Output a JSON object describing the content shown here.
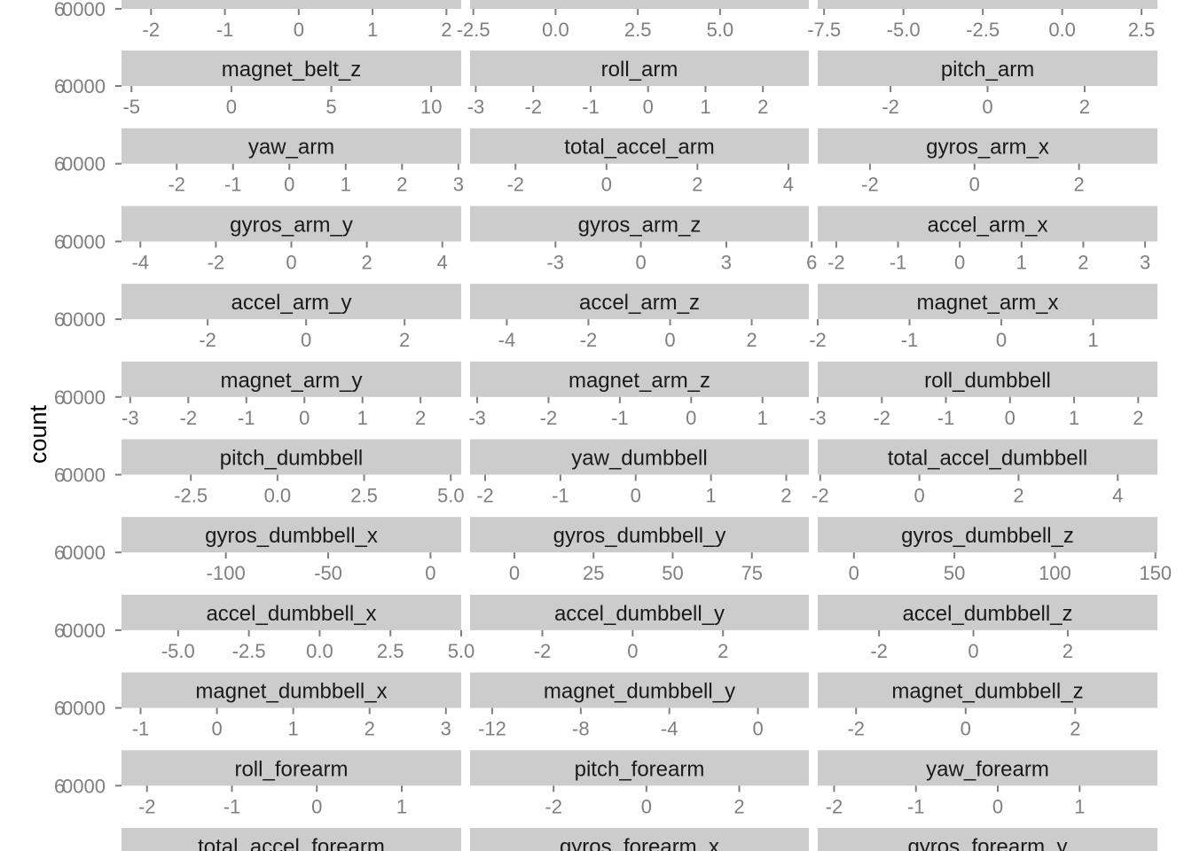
{
  "chart_data": {
    "type": "bar",
    "ylabel": "count",
    "y_tick_label": "0000",
    "y_tick_label_overlay": "6",
    "grid": false,
    "colors": {
      "strip_background": "#cccccc",
      "tick": "#7f7f7f",
      "strip_text": "#1a1a1a"
    },
    "top_partial_axes": [
      {
        "ticks": [
          -2,
          -1,
          0,
          1,
          2
        ],
        "range": [
          -2.4,
          2.2
        ]
      },
      {
        "ticks": [
          -2.5,
          0.0,
          2.5,
          5.0
        ],
        "tick_labels": [
          "-2.5",
          "0.0",
          "2.5",
          "5.0"
        ],
        "range": [
          -2.6,
          7.7
        ]
      },
      {
        "ticks": [
          -7.5,
          -5.0,
          -2.5,
          0.0,
          2.5
        ],
        "tick_labels": [
          "-7.5",
          "-5.0",
          "-2.5",
          "0.0",
          "2.5"
        ],
        "range": [
          -7.7,
          3.0
        ]
      }
    ],
    "panels": [
      {
        "name": "magnet_belt_z",
        "ticks": [
          -5,
          0,
          5,
          10
        ],
        "range": [
          -5.5,
          11.5
        ]
      },
      {
        "name": "roll_arm",
        "ticks": [
          -3,
          -2,
          -1,
          0,
          1,
          2
        ],
        "range": [
          -3.1,
          2.8
        ]
      },
      {
        "name": "pitch_arm",
        "ticks": [
          -2,
          0,
          2
        ],
        "range": [
          -3.5,
          3.5
        ]
      },
      {
        "name": "yaw_arm",
        "ticks": [
          -2,
          -1,
          0,
          1,
          2,
          3
        ],
        "range": [
          -2.98,
          3.05
        ]
      },
      {
        "name": "total_accel_arm",
        "ticks": [
          -2,
          0,
          2,
          4
        ],
        "range": [
          -3.0,
          4.45
        ]
      },
      {
        "name": "gyros_arm_x",
        "ticks": [
          -2,
          0,
          2
        ],
        "range": [
          -3.0,
          3.5
        ]
      },
      {
        "name": "gyros_arm_y",
        "ticks": [
          -4,
          -2,
          0,
          2,
          4
        ],
        "range": [
          -4.5,
          4.5
        ]
      },
      {
        "name": "gyros_arm_z",
        "ticks": [
          -3,
          0,
          3,
          6
        ],
        "range": [
          -6.0,
          5.9
        ]
      },
      {
        "name": "accel_arm_x",
        "ticks": [
          -2,
          -1,
          0,
          1,
          2,
          3
        ],
        "range": [
          -2.3,
          3.2
        ]
      },
      {
        "name": "accel_arm_y",
        "ticks": [
          -2,
          0,
          2
        ],
        "range": [
          -3.75,
          3.15
        ]
      },
      {
        "name": "accel_arm_z",
        "ticks": [
          -4,
          0,
          -2,
          2
        ],
        "tick_order": [
          -4,
          -2,
          0,
          2
        ],
        "range": [
          -4.9,
          3.4
        ]
      },
      {
        "name": "magnet_arm_x",
        "ticks": [
          -2,
          -1,
          0,
          1
        ],
        "range": [
          -2.0,
          1.7
        ]
      },
      {
        "name": "magnet_arm_y",
        "ticks": [
          -3,
          -2,
          -1,
          0,
          1,
          2
        ],
        "range": [
          -3.15,
          2.7
        ]
      },
      {
        "name": "magnet_arm_z",
        "ticks": [
          -3,
          -2,
          -1,
          0,
          1
        ],
        "range": [
          -3.1,
          1.65
        ]
      },
      {
        "name": "roll_dumbbell",
        "ticks": [
          -3,
          -2,
          -1,
          0,
          1,
          2
        ],
        "range": [
          -3.0,
          2.3
        ]
      },
      {
        "name": "pitch_dumbbell",
        "ticks": [
          -2.5,
          0.0,
          2.5,
          5.0
        ],
        "tick_labels": [
          "-2.5",
          "0.0",
          "2.5",
          "5.0"
        ],
        "range": [
          -4.5,
          5.3
        ]
      },
      {
        "name": "yaw_dumbbell",
        "ticks": [
          -2,
          -1,
          0,
          1,
          2
        ],
        "range": [
          -2.2,
          2.3
        ]
      },
      {
        "name": "total_accel_dumbbell",
        "ticks": [
          -2,
          0,
          2,
          4
        ],
        "range": [
          -2.05,
          4.8
        ]
      },
      {
        "name": "gyros_dumbbell_x",
        "ticks": [
          -100,
          -50,
          0
        ],
        "range": [
          -151,
          15
        ]
      },
      {
        "name": "gyros_dumbbell_y",
        "ticks": [
          0,
          25,
          50,
          75
        ],
        "range": [
          -14,
          93
        ]
      },
      {
        "name": "gyros_dumbbell_z",
        "ticks": [
          0,
          50,
          100,
          150
        ],
        "range": [
          -18,
          151
        ]
      },
      {
        "name": "accel_dumbbell_x",
        "ticks": [
          -5.0,
          -2.5,
          0.0,
          2.5,
          5.0
        ],
        "tick_labels": [
          "-5.0",
          "-2.5",
          "0.0",
          "2.5",
          "5.0"
        ],
        "range": [
          -7.0,
          5.0
        ]
      },
      {
        "name": "accel_dumbbell_y",
        "ticks": [
          -2,
          0,
          2
        ],
        "range": [
          -3.6,
          3.9
        ]
      },
      {
        "name": "accel_dumbbell_z",
        "ticks": [
          -2,
          0,
          2
        ],
        "range": [
          -3.3,
          3.9
        ]
      },
      {
        "name": "magnet_dumbbell_x",
        "ticks": [
          -1,
          0,
          1,
          2,
          3
        ],
        "range": [
          -1.25,
          3.2
        ]
      },
      {
        "name": "magnet_dumbbell_y",
        "ticks": [
          -12,
          -8,
          -4,
          0
        ],
        "range": [
          -13.0,
          2.3
        ]
      },
      {
        "name": "magnet_dumbbell_z",
        "ticks": [
          -2,
          0,
          2
        ],
        "range": [
          -2.7,
          3.5
        ]
      },
      {
        "name": "roll_forearm",
        "ticks": [
          -2,
          -1,
          0,
          1
        ],
        "range": [
          -2.3,
          1.7
        ]
      },
      {
        "name": "pitch_forearm",
        "ticks": [
          -2,
          0,
          2
        ],
        "range": [
          -3.8,
          3.5
        ]
      },
      {
        "name": "yaw_forearm",
        "ticks": [
          -2,
          -1,
          0,
          1
        ],
        "range": [
          -2.2,
          1.95
        ]
      },
      {
        "name": "total_accel_forearm"
      },
      {
        "name": "gyros_forearm_x"
      },
      {
        "name": "gyros_forearm_y"
      }
    ]
  }
}
